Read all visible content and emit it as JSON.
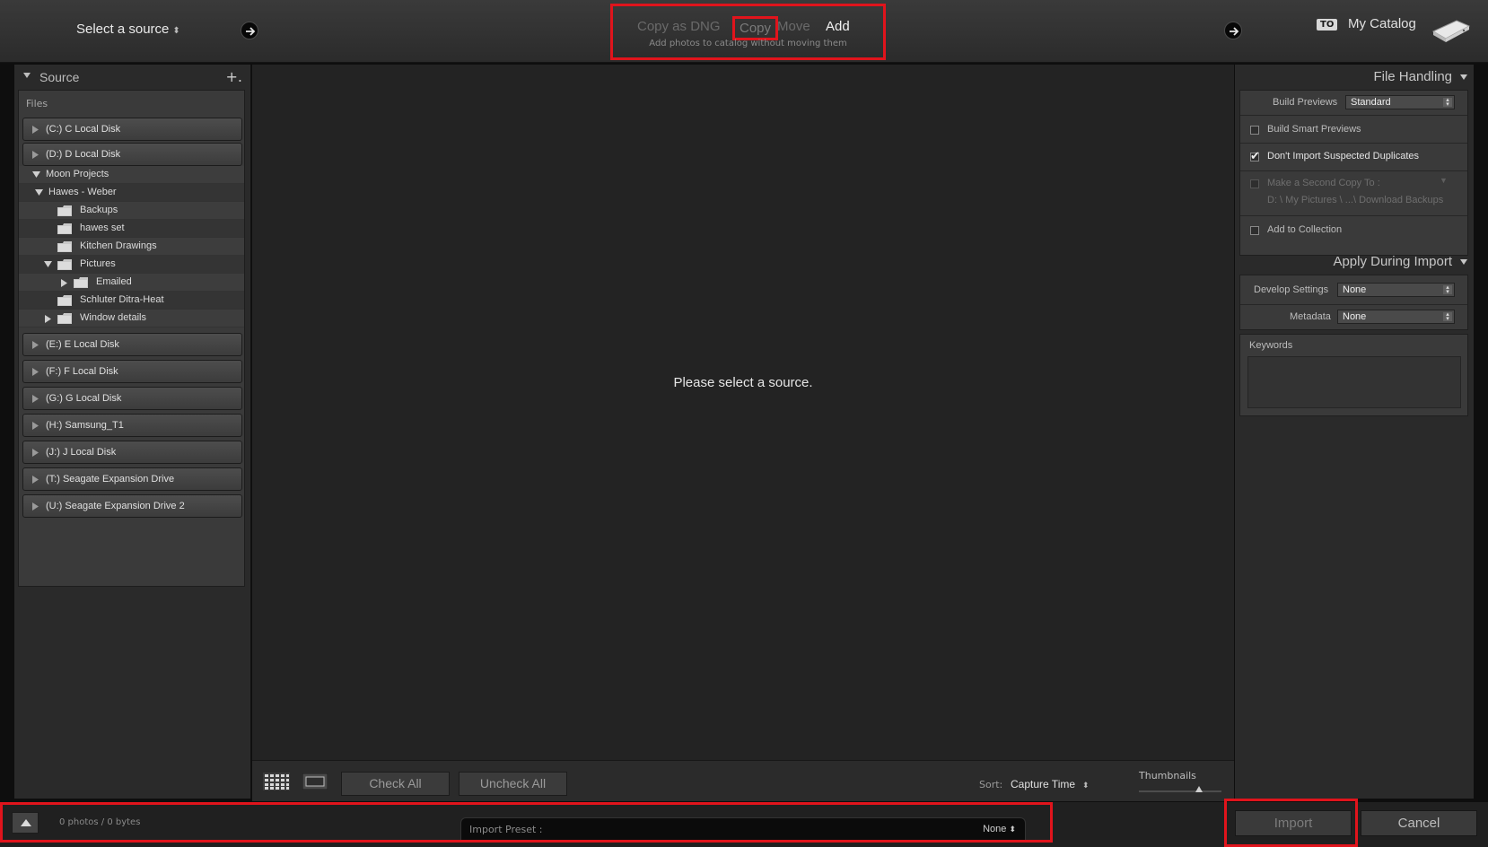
{
  "topbar": {
    "select_source": "Select a source",
    "modes": [
      "Copy as DNG",
      "Copy",
      "Move",
      "Add"
    ],
    "active_mode": "Add",
    "mode_description": "Add photos to catalog without moving them",
    "to_badge": "TO",
    "catalog_name": "My Catalog"
  },
  "source_panel": {
    "title": "Source",
    "add_label": "+.",
    "files_label": "Files",
    "disks_top": [
      {
        "label": "(C:) C Local Disk"
      },
      {
        "label": "(D:) D Local Disk"
      }
    ],
    "tree": [
      {
        "label": "Moon Projects"
      },
      {
        "label": "Hawes - Weber"
      },
      {
        "label": "Backups"
      },
      {
        "label": "hawes set"
      },
      {
        "label": "Kitchen Drawings"
      },
      {
        "label": "Pictures"
      },
      {
        "label": "Emailed"
      },
      {
        "label": "Schluter Ditra-Heat"
      },
      {
        "label": "Window details"
      }
    ],
    "disks_bottom": [
      {
        "label": "(E:) E Local Disk"
      },
      {
        "label": "(F:) F Local Disk"
      },
      {
        "label": "(G:) G Local Disk"
      },
      {
        "label": "(H:) Samsung_T1"
      },
      {
        "label": "(J:) J Local Disk"
      },
      {
        "label": "(T:) Seagate Expansion Drive"
      },
      {
        "label": "(U:) Seagate Expansion Drive 2"
      }
    ]
  },
  "center": {
    "message": "Please select a source.",
    "toolbar": {
      "check_all": "Check All",
      "uncheck_all": "Uncheck All",
      "sort_label": "Sort:",
      "sort_value": "Capture Time",
      "thumbnails_label": "Thumbnails",
      "thumbnail_size": 0.73
    }
  },
  "file_handling": {
    "title": "File Handling",
    "build_previews_label": "Build Previews",
    "build_previews_value": "Standard",
    "smart_previews_label": "Build Smart Previews",
    "smart_previews_checked": false,
    "no_duplicates_label": "Don't Import Suspected Duplicates",
    "no_duplicates_checked": true,
    "second_copy_label": "Make a Second Copy To :",
    "second_copy_path": "D: \\ My Pictures \\ ...\\ Download Backups",
    "add_collection_label": "Add to Collection",
    "add_collection_checked": false
  },
  "apply_during_import": {
    "title": "Apply During Import",
    "develop_label": "Develop Settings",
    "develop_value": "None",
    "metadata_label": "Metadata",
    "metadata_value": "None",
    "keywords_label": "Keywords"
  },
  "bottombar": {
    "photos_count": "0 photos / 0 bytes",
    "preset_label": "Import Preset :",
    "preset_value": "None",
    "import_label": "Import",
    "cancel_label": "Cancel"
  },
  "colors": {
    "highlight_outline": "#e0141c",
    "panel_bg": "#2a2a2a",
    "center_bg": "#232323"
  }
}
